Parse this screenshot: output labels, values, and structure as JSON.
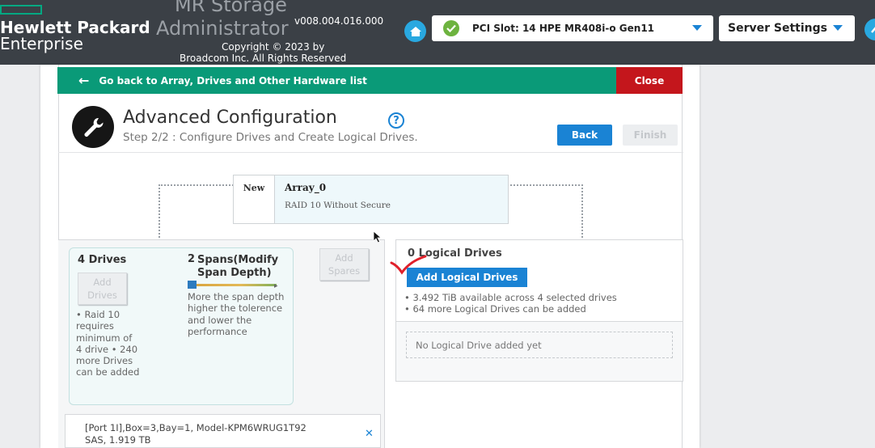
{
  "header": {
    "brand_line1": "Hewlett Packard",
    "brand_line2": "Enterprise",
    "app_title_line1": "MR Storage",
    "app_title_line2": "Administrator",
    "version": "v008.004.016.000",
    "copyright_line1": "Copyright © 2023 by",
    "copyright_line2": "Broadcom Inc. All Rights Reserved",
    "controller_select": "PCI Slot: 14 HPE MR408i-o Gen11",
    "server_settings": "Server Settings"
  },
  "nav": {
    "back_label": "Go back to Array, Drives and Other Hardware list",
    "close_label": "Close"
  },
  "page": {
    "title": "Advanced Configuration",
    "subtitle": "Step 2/2 : Configure Drives and Create Logical Drives.",
    "back_button": "Back",
    "finish_button": "Finish"
  },
  "array": {
    "status": "New",
    "name": "Array_0",
    "raid": "RAID 10 Without Secure"
  },
  "drives": {
    "title": "4 Drives",
    "add_button": "Add Drives",
    "note": "• Raid 10 requires minimum of 4 drive • 240 more Drives can be added",
    "spans_count": "2",
    "spans_title": "Spans(Modify Span Depth)",
    "spans_note": "More the span depth higher the tolerence and lower the performance",
    "add_spares": "Add Spares",
    "selected_drive_line1": "[Port 1I],Box=3,Bay=1, Model-KPM6WRUG1T92",
    "selected_drive_line2": "SAS, 1.919 TB"
  },
  "logical_drives": {
    "title": "0 Logical Drives",
    "add_button": "Add Logical Drives",
    "note1": "• 3.492 TiB available across 4 selected drives",
    "note2": "• 64 more Logical Drives can be added",
    "empty_message": "No Logical Drive added yet"
  },
  "colors": {
    "header_bg": "#3b4046",
    "accent_green": "#0a9a78",
    "close_red": "#c4161c",
    "primary_blue": "#1a83d4"
  }
}
